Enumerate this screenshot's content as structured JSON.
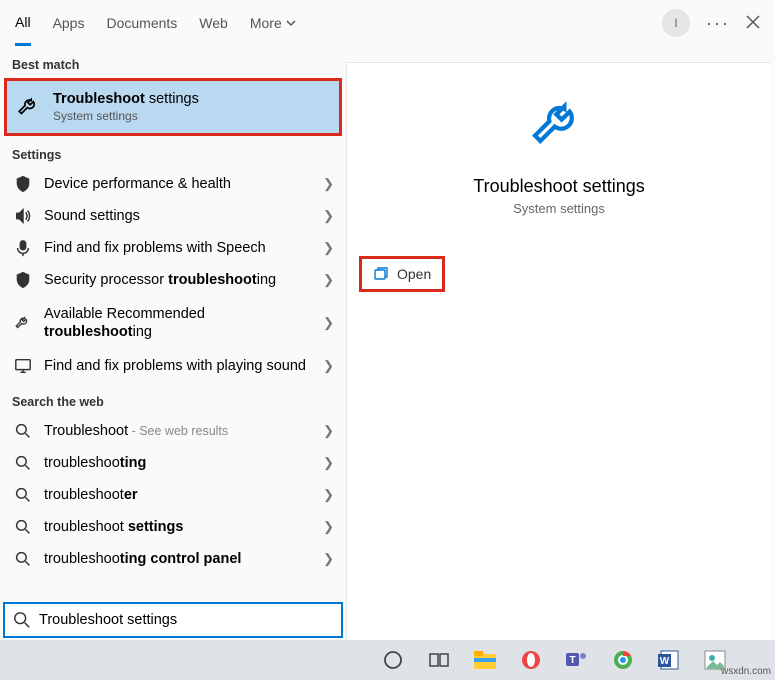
{
  "tabs": {
    "all": "All",
    "apps": "Apps",
    "documents": "Documents",
    "web": "Web",
    "more": "More"
  },
  "sections": {
    "best_match": "Best match",
    "settings": "Settings",
    "search_web": "Search the web"
  },
  "best_match": {
    "title_plain": "Troubleshoot",
    "title_light": " settings",
    "subtitle": "System settings"
  },
  "settings_items": [
    {
      "icon": "shield",
      "label": "Device performance & health"
    },
    {
      "icon": "speaker",
      "label": "Sound settings"
    },
    {
      "icon": "mic",
      "label": "Find and fix problems with Speech"
    },
    {
      "icon": "shield",
      "label_html": "Security processor <b>troubleshoot</b>ing"
    },
    {
      "icon": "wrench",
      "label_html": "Available Recommended <b>troubleshoot</b>ing",
      "multiline": true
    },
    {
      "icon": "monitor",
      "label": "Find and fix problems with playing sound",
      "multiline": true
    }
  ],
  "web_items": [
    {
      "label_html": "Troubleshoot",
      "sub": " - See web results"
    },
    {
      "label_html": "troubleshoo<b>ting</b>"
    },
    {
      "label_html": "troubleshoot<b>er</b>"
    },
    {
      "label_html": "troubleshoot <b>settings</b>"
    },
    {
      "label_html": "troubleshoo<b>ting control panel</b>"
    }
  ],
  "preview": {
    "title": "Troubleshoot settings",
    "subtitle": "System settings",
    "open": "Open"
  },
  "search": {
    "value": "Troubleshoot settings"
  },
  "avatar": "I",
  "watermark": "wsxdn.com"
}
